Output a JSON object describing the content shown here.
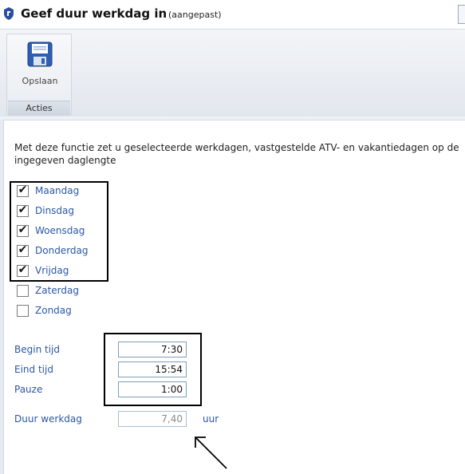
{
  "window": {
    "title": "Geef duur werkdag in",
    "subtitle": "(aangepast)"
  },
  "ribbon": {
    "save_label": "Opslaan",
    "group_label": "Acties"
  },
  "intro_text": "Met deze functie zet u geselecteerde werkdagen, vastgestelde ATV- en vakantiedagen op de ingegeven daglengte",
  "days": [
    {
      "label": "Maandag",
      "checked": true
    },
    {
      "label": "Dinsdag",
      "checked": true
    },
    {
      "label": "Woensdag",
      "checked": true
    },
    {
      "label": "Donderdag",
      "checked": true
    },
    {
      "label": "Vrijdag",
      "checked": true
    },
    {
      "label": "Zaterdag",
      "checked": false
    },
    {
      "label": "Zondag",
      "checked": false
    }
  ],
  "fields": {
    "begin": {
      "label": "Begin tijd",
      "value": "7:30"
    },
    "end": {
      "label": "Eind tijd",
      "value": "15:54"
    },
    "pause": {
      "label": "Pauze",
      "value": "1:00"
    },
    "duration": {
      "label": "Duur werkdag",
      "value": "7,40",
      "unit": "uur"
    }
  },
  "colors": {
    "label_blue": "#2a57a4",
    "annotation": "#000000"
  },
  "icons": {
    "app": "shield-icon",
    "save": "floppy-disk-icon",
    "checkmark": "✔"
  }
}
